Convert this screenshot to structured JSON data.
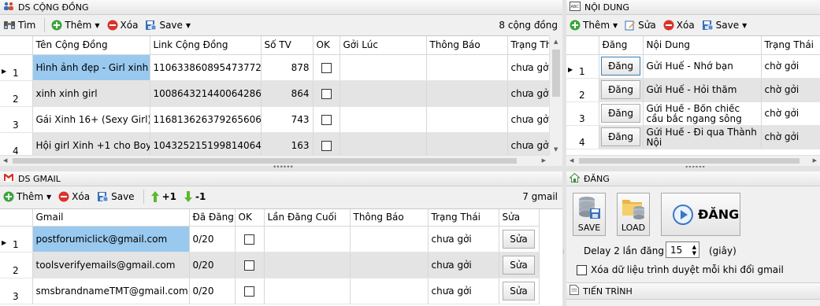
{
  "community": {
    "title": "DS CỘNG ĐỒNG",
    "toolbar": {
      "find": "Tìm",
      "add": "Thêm",
      "delete": "Xóa",
      "save": "Save",
      "count": "8 cộng đồng"
    },
    "columns": [
      "Tên Cộng Đồng",
      "Link Cộng Đồng",
      "Số TV",
      "OK",
      "Gởi Lúc",
      "Thông Báo",
      "Trạng Thái"
    ],
    "rows": [
      {
        "n": "1",
        "name": "Hình ảnh đẹp - Girl xinh ...",
        "link": "1106338608954737720​82",
        "members": "878",
        "status": "chưa gởi"
      },
      {
        "n": "2",
        "name": "xinh xinh girl",
        "link": "100864321440064286788",
        "members": "864",
        "status": "chưa gởi"
      },
      {
        "n": "3",
        "name": "Gái Xinh 16+ (Sexy Girl)",
        "link": "116813626379265606327",
        "members": "743",
        "status": "chưa gởi"
      },
      {
        "n": "4",
        "name": "Hội girl Xinh +1 cho Boy...",
        "link": "104325215199814064370",
        "members": "163",
        "status": "chưa gởi"
      }
    ]
  },
  "content": {
    "title": "NỘI DUNG",
    "toolbar": {
      "add": "Thêm",
      "edit": "Sửa",
      "delete": "Xóa",
      "save": "Save"
    },
    "columns": [
      "Đăng",
      "Nội Dung",
      "Trạng Thái"
    ],
    "rows": [
      {
        "n": "1",
        "btn": "Đăng",
        "text": "Gửi Huế - Nhớ bạn",
        "status": "chờ gởi"
      },
      {
        "n": "2",
        "btn": "Đăng",
        "text": "Gửi Huế - Hỏi thăm",
        "status": "chờ gởi"
      },
      {
        "n": "3",
        "btn": "Đăng",
        "text": "Gửi Huế - Bốn chiếc cầu bắc ngang sông Hương",
        "status": "chờ gởi"
      },
      {
        "n": "4",
        "btn": "Đăng",
        "text": "Gửi Huế - Đi qua Thành Nội",
        "status": "chờ gởi"
      }
    ]
  },
  "gmail": {
    "title": "DS GMAIL",
    "toolbar": {
      "add": "Thêm",
      "delete": "Xóa",
      "save": "Save",
      "plus": "+1",
      "minus": "-1",
      "count": "7 gmail"
    },
    "columns": [
      "Gmail",
      "Đã Đăng",
      "OK",
      "Lần Đăng Cuối",
      "Thông Báo",
      "Trạng Thái",
      "Sửa"
    ],
    "rows": [
      {
        "n": "1",
        "email": "postforumiclick@gmail.com",
        "posted": "0/20",
        "status": "chưa gởi",
        "btn": "Sửa"
      },
      {
        "n": "2",
        "email": "toolsverifyemails@gmail.com",
        "posted": "0/20",
        "status": "chưa gởi",
        "btn": "Sửa"
      },
      {
        "n": "3",
        "email": "smsbrandnameTMT@gmail.com",
        "posted": "0/20",
        "status": "chưa gởi",
        "btn": "Sửa"
      }
    ]
  },
  "post": {
    "title": "ĐĂNG",
    "save": "SAVE",
    "load": "LOAD",
    "post": "ĐĂNG",
    "delay_label": "Delay 2 lần đăng",
    "delay_value": "15",
    "delay_unit": "(giây)",
    "clear_label": "Xóa dữ liệu trình duyệt mỗi khi đổi gmail"
  },
  "progress": {
    "title": "TIẾN TRÌNH"
  }
}
